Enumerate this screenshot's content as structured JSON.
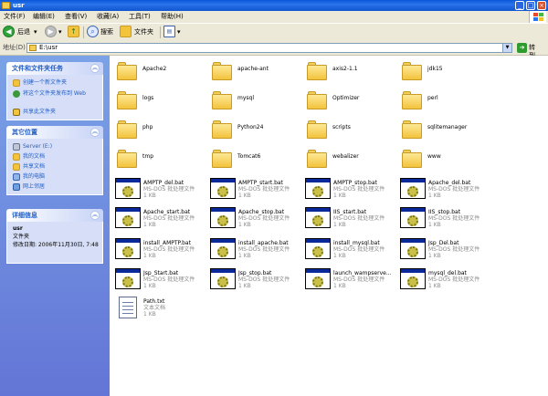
{
  "window": {
    "title": "usr",
    "buttons": {
      "minimize": "_",
      "maximize": "□",
      "close": "×"
    }
  },
  "menu": [
    "文件(F)",
    "编辑(E)",
    "查看(V)",
    "收藏(A)",
    "工具(T)",
    "帮助(H)"
  ],
  "toolbar": {
    "back_label": "后退",
    "search_label": "搜索",
    "folders_label": "文件夹",
    "dropdown_glyph": "▾"
  },
  "address": {
    "label": "地址(D)",
    "value": "E:\\usr",
    "go_label": "转到"
  },
  "tasks": {
    "file_folder": {
      "title": "文件和文件夹任务",
      "items": [
        "创建一个新文件夹",
        "将这个文件夹发布到 Web",
        "共享此文件夹"
      ]
    },
    "other_places": {
      "title": "其它位置",
      "items": [
        "Server (E:)",
        "我的文档",
        "共享文档",
        "我的电脑",
        "网上邻居"
      ]
    },
    "details": {
      "title": "详细信息",
      "name": "usr",
      "type": "文件夹",
      "modified": "修改日期: 2006年11月30日, 7:48"
    }
  },
  "folders": [
    "Apache2",
    "apache-ant",
    "axis2-1.1",
    "jdk15",
    "logs",
    "mysql",
    "Optimizer",
    "perl",
    "php",
    "Python24",
    "scripts",
    "sqlitemanager",
    "tmp",
    "Tomcat6",
    "webalizer",
    "www"
  ],
  "files": [
    {
      "name": "AMPTP_del.bat",
      "type": "MS-DOS 批处理文件",
      "size": "1 KB"
    },
    {
      "name": "AMPTP_start.bat",
      "type": "MS-DOS 批处理文件",
      "size": "1 KB"
    },
    {
      "name": "AMPTP_stop.bat",
      "type": "MS-DOS 批处理文件",
      "size": "1 KB"
    },
    {
      "name": "Apache_del.bat",
      "type": "MS-DOS 批处理文件",
      "size": "1 KB"
    },
    {
      "name": "Apache_start.bat",
      "type": "MS-DOS 批处理文件",
      "size": "1 KB"
    },
    {
      "name": "Apache_stop.bat",
      "type": "MS-DOS 批处理文件",
      "size": "1 KB"
    },
    {
      "name": "IIS_start.bat",
      "type": "MS-DOS 批处理文件",
      "size": "1 KB"
    },
    {
      "name": "IIS_stop.bat",
      "type": "MS-DOS 批处理文件",
      "size": "1 KB"
    },
    {
      "name": "install_AMPTP.bat",
      "type": "MS-DOS 批处理文件",
      "size": "1 KB"
    },
    {
      "name": "install_apache.bat",
      "type": "MS-DOS 批处理文件",
      "size": "1 KB"
    },
    {
      "name": "install_mysql.bat",
      "type": "MS-DOS 批处理文件",
      "size": "1 KB"
    },
    {
      "name": "Jsp_Del.bat",
      "type": "MS-DOS 批处理文件",
      "size": "1 KB"
    },
    {
      "name": "Jsp_Start.bat",
      "type": "MS-DOS 批处理文件",
      "size": "1 KB"
    },
    {
      "name": "Jsp_stop.bat",
      "type": "MS-DOS 批处理文件",
      "size": "1 KB"
    },
    {
      "name": "launch_wampserve...",
      "type": "MS-DOS 批处理文件",
      "size": "1 KB"
    },
    {
      "name": "mysql_del.bat",
      "type": "MS-DOS 批处理文件",
      "size": "1 KB"
    }
  ],
  "text_file": {
    "name": "Path.txt",
    "type": "文本文档",
    "size": "1 KB"
  },
  "icons": {
    "back": "back-arrow-icon",
    "forward": "forward-arrow-icon",
    "up": "up-folder-icon",
    "search": "search-icon",
    "folders": "folders-icon",
    "views": "views-icon",
    "go": "go-arrow-icon"
  },
  "colors": {
    "title_bar": "#0a57d8",
    "task_pane": "#6f8ee0",
    "link": "#215dc6",
    "folder": "#f3c33c"
  }
}
